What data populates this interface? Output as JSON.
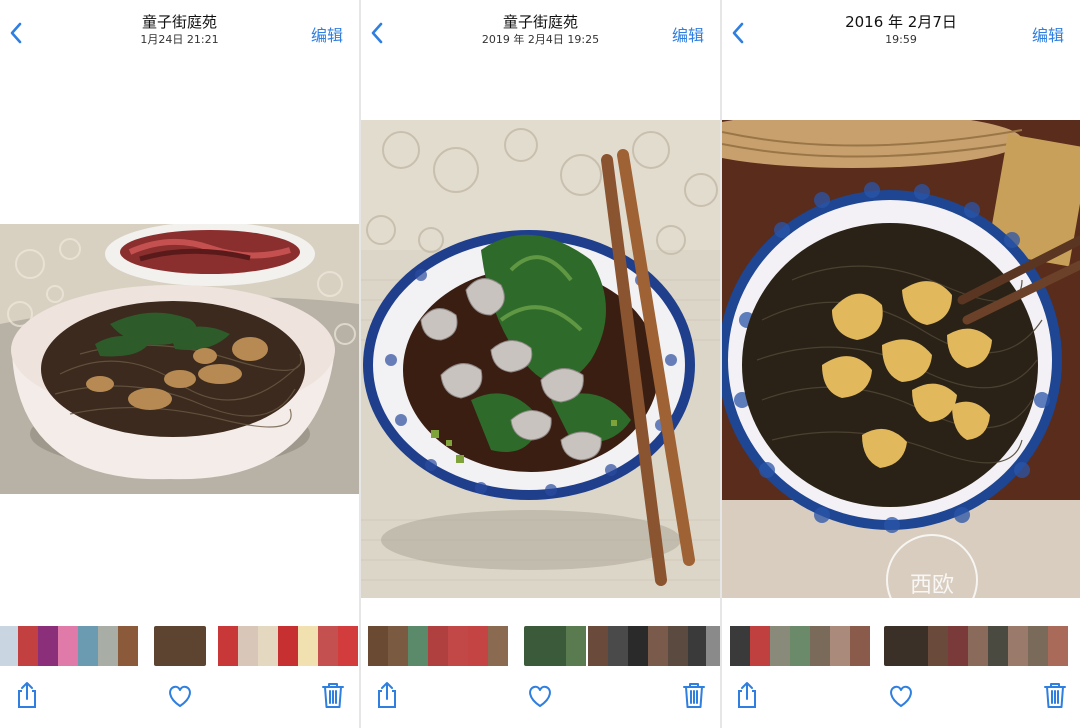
{
  "panels": [
    {
      "title": "童子街庭苑",
      "subtitle": "1月24日  21:21",
      "edit_label": "编辑",
      "colors": {
        "accent": "#2f7fe0"
      },
      "icons": {
        "back": "chevron-left-icon",
        "share": "share-icon",
        "favorite": "heart-icon",
        "delete": "trash-icon"
      }
    },
    {
      "title": "童子街庭苑",
      "subtitle": "2019 年 2月4日  19:25",
      "edit_label": "编辑",
      "colors": {
        "accent": "#2f7fe0"
      },
      "icons": {
        "back": "chevron-left-icon",
        "share": "share-icon",
        "favorite": "heart-icon",
        "delete": "trash-icon"
      }
    },
    {
      "title": "2016 年 2月7日",
      "subtitle": "19:59",
      "edit_label": "编辑",
      "colors": {
        "accent": "#2f7fe0"
      },
      "icons": {
        "back": "chevron-left-icon",
        "share": "share-icon",
        "favorite": "heart-icon",
        "delete": "trash-icon"
      },
      "watermark_text": "西欧"
    }
  ]
}
